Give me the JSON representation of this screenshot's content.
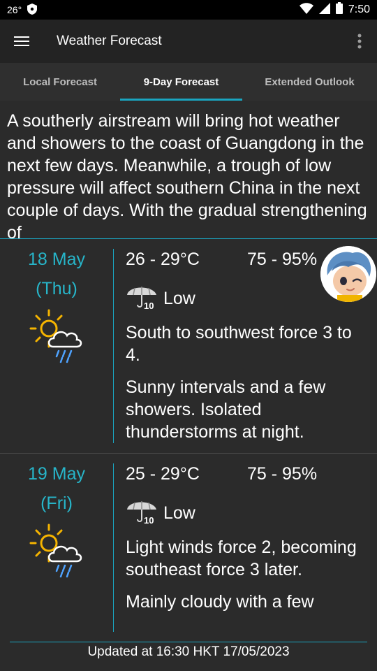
{
  "status_bar": {
    "temperature": "26°",
    "time": "7:50",
    "icons": [
      "shield-icon",
      "wifi-icon",
      "signal-icon",
      "battery-icon"
    ]
  },
  "app_bar": {
    "title": "Weather Forecast",
    "menu_icon": "hamburger-menu-icon",
    "more_icon": "more-vertical-icon"
  },
  "tabs": [
    {
      "label": "Local Forecast",
      "active": false
    },
    {
      "label": "9-Day Forecast",
      "active": true
    },
    {
      "label": "Extended Outlook",
      "active": false
    }
  ],
  "summary": "A southerly airstream will bring hot weather and showers to the coast of Guangdong in the next few days. Meanwhile, a trough of low pressure will affect southern China in the next couple of days. With the gradual strengthening of",
  "forecasts": [
    {
      "date": "18 May",
      "weekday": "(Thu)",
      "temperature": "26 - 29°C",
      "humidity": "75 - 95%",
      "psr": "Low",
      "psr_icon_label": "10",
      "wind": "South to southwest force 3 to 4.",
      "description": "Sunny intervals and a few showers. Isolated thunderstorms at night.",
      "weather_icon": "sun-cloud-rain-icon"
    },
    {
      "date": "19 May",
      "weekday": "(Fri)",
      "temperature": "25 - 29°C",
      "humidity": "75 - 95%",
      "psr": "Low",
      "psr_icon_label": "10",
      "wind": "Light winds force 2, becoming southeast force 3 later.",
      "description": "Mainly cloudy with a few",
      "weather_icon": "sun-cloud-rain-icon"
    }
  ],
  "footer": {
    "updated": "Updated at 16:30 HKT 17/05/2023"
  },
  "colors": {
    "accent": "#1aa5c0",
    "date_text": "#27b5c9",
    "background": "#2b2b2b",
    "app_bar": "#232323"
  }
}
